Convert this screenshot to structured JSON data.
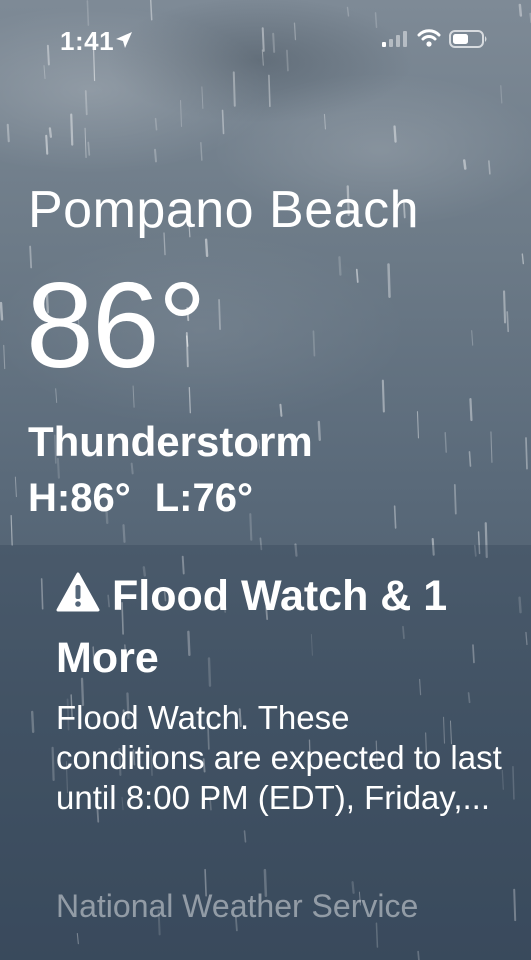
{
  "status_bar": {
    "time": "1:41"
  },
  "weather": {
    "city": "Pompano Beach",
    "temperature": "86°",
    "condition": "Thunderstorm",
    "high": "H:86°",
    "low": "L:76°"
  },
  "alert": {
    "title": "Flood Watch & 1 More",
    "body": "Flood Watch. These conditions are expected to last until 8:00 PM (EDT), Friday,...",
    "source": "National Weather Service"
  },
  "icons": {
    "location": "location-arrow-icon",
    "signal": "cellular-signal-icon",
    "wifi": "wifi-icon",
    "battery": "battery-icon",
    "alert": "warning-triangle-icon"
  }
}
